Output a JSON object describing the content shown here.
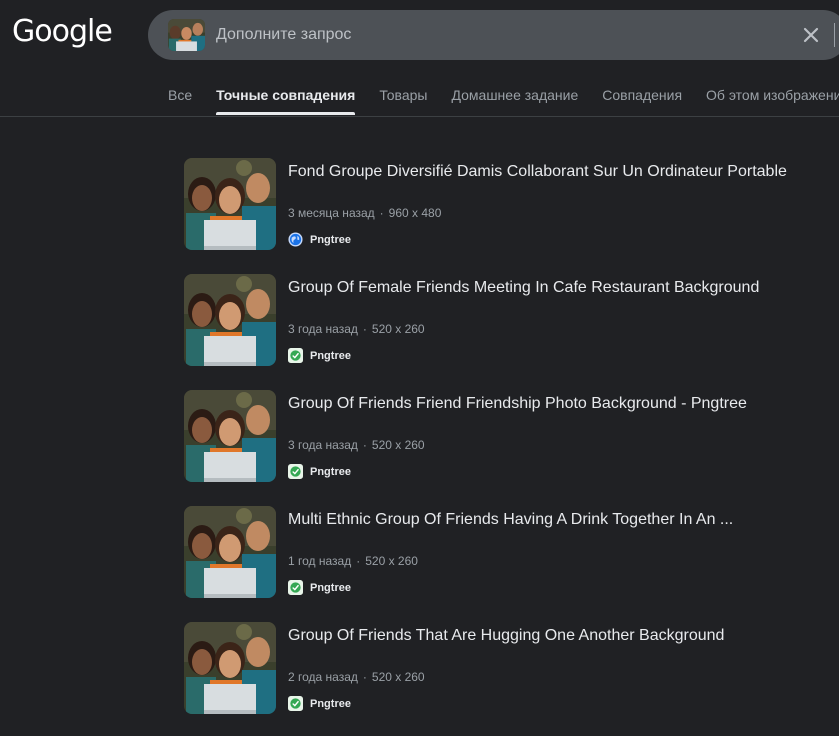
{
  "header": {
    "logo_text": "Google",
    "search": {
      "placeholder": "Дополните запрос",
      "value": ""
    }
  },
  "tabs": [
    {
      "label": "Все",
      "active": false
    },
    {
      "label": "Точные совпадения",
      "active": true
    },
    {
      "label": "Товары",
      "active": false
    },
    {
      "label": "Домашнее задание",
      "active": false
    },
    {
      "label": "Совпадения",
      "active": false
    },
    {
      "label": "Об этом изображении",
      "active": false
    }
  ],
  "results": [
    {
      "title": "Fond Groupe Diversifié Damis Collaborant Sur Un Ordinateur Portable",
      "age": "3 месяца назад",
      "dimensions": "960 x 480",
      "source": "Pngtree",
      "favicon": "globe-icon"
    },
    {
      "title": "Group Of Female Friends Meeting In Cafe Restaurant Background",
      "age": "3 года назад",
      "dimensions": "520 x 260",
      "source": "Pngtree",
      "favicon": "pngtree-icon"
    },
    {
      "title": "Group Of Friends Friend Friendship Photo Background - Pngtree",
      "age": "3 года назад",
      "dimensions": "520 x 260",
      "source": "Pngtree",
      "favicon": "pngtree-icon"
    },
    {
      "title": "Multi Ethnic Group Of Friends Having A Drink Together In An ...",
      "age": "1 год назад",
      "dimensions": "520 x 260",
      "source": "Pngtree",
      "favicon": "pngtree-icon"
    },
    {
      "title": "Group Of Friends That Are Hugging One Another Background",
      "age": "2 года назад",
      "dimensions": "520 x 260",
      "source": "Pngtree",
      "favicon": "pngtree-icon"
    }
  ],
  "colors": {
    "background": "#202124",
    "search_bg": "#4d5156",
    "text_primary": "#e8eaed",
    "text_secondary": "#9aa0a6"
  }
}
